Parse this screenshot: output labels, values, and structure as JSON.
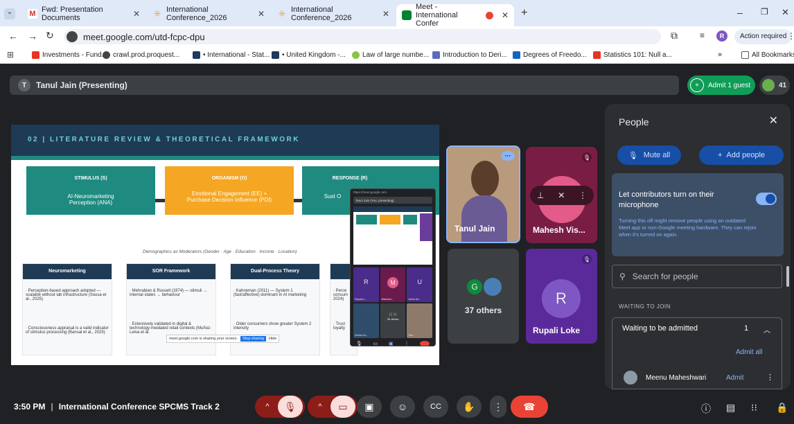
{
  "tabs": [
    {
      "title": "Fwd: Presentation Documents",
      "icon": "gmail-icon"
    },
    {
      "title": "International Conference_2026",
      "icon": "conference-icon"
    },
    {
      "title": "International Conference_2026",
      "icon": "conference-icon"
    },
    {
      "title": "Meet - International Confer",
      "icon": "meet-icon"
    }
  ],
  "address": {
    "url": "meet.google.com/utd-fcpc-dpu",
    "action_required": "Action required",
    "profile_initial": "R"
  },
  "bookmarks": [
    "Investments - Fund...",
    "crawl.prod.proquest...",
    "• International - Stat...",
    "• United Kingdom -...",
    "Law of large numbe...",
    "Introduction to Deri...",
    "Degrees of Freedo...",
    "Statistics 101: Null a..."
  ],
  "all_bookmarks": "All Bookmarks",
  "bookmarks_more": "»",
  "meet": {
    "presenter_initial": "T",
    "presenter_label": "Tanul Jain (Presenting)",
    "admit_button": "Admit 1 guest",
    "participant_count": "41",
    "time": "3:50 PM",
    "meeting_title": "International Conference SPCMS Track 2"
  },
  "slide": {
    "heading": "02  |  LITERATURE REVIEW & THEORETICAL FRAMEWORK",
    "stimulus_title": "STIMULUS (S)",
    "stimulus_body": "AI-Neuromarketing Perception (ANA)",
    "organism_title": "ORGANISM (O)",
    "organism_body": "Emotional Engagement (EE) + Purchase Decision Influence (PDI)",
    "response_title": "RESPONSE (R)",
    "response_body": "Sust O",
    "moderators": "Demographics as Moderators (Gender · Age · Education · Income · Location)",
    "cards": [
      {
        "title": "Neuromarketing",
        "p1": "· Perception-based approach adopted — scalable without lab infrastructure (Sousa et al., 2025)",
        "p2": "· Consciousness appraisal is a valid indicator of stimulus processing (Bansal et al., 2025)"
      },
      {
        "title": "SOR Framework",
        "p1": "· Mehrabian & Russell (1974) — stimuli → internal states → behaviour",
        "p2": "· Extensively validated in digital & technology-mediated retail contexts (Muñoz-Leiva et al."
      },
      {
        "title": "Dual-Process Theory",
        "p1": "· Kahneman (2011) — System 1 (fast/affective) dominant in AI marketing",
        "p2": "· Older consumers show greater System 2 intensity"
      },
      {
        "title": "",
        "p1": "· Perce consum 2024)",
        "p2": "· Trust loyalty"
      }
    ],
    "sharing_notice": "meet.google.com is sharing your screen.",
    "stop_sharing": "Stop sharing",
    "hide": "Hide"
  },
  "pip": {
    "url": "https://meet.google.com",
    "presenter": "Tanul Jain (You, presenting)",
    "tiles": [
      {
        "initial": "R",
        "name": "Rupali L..."
      },
      {
        "initial": "M",
        "name": "Mahesh..."
      },
      {
        "initial": "U",
        "name": "Usha Kir..."
      },
      {
        "initial": "",
        "name": "Disha Ku..."
      },
      {
        "initial": "G N",
        "name": "35 others"
      },
      {
        "initial": "",
        "name": "Tan..."
      }
    ]
  },
  "tiles": {
    "tanul": "Tanul Jain",
    "mahesh": "Mahesh Vis...",
    "others_initial": "G",
    "others": "37 others",
    "rupali_initial": "R",
    "rupali": "Rupali Loke"
  },
  "people": {
    "title": "People",
    "mute_all": "Mute all",
    "add_people": "Add people",
    "contrib_title": "Let contributors turn on their microphone",
    "contrib_desc": "Turning this off might remove people using an outdated Meet app or non-Google meeting hardware. They can rejoin when it's turned on again.",
    "search_placeholder": "Search for people",
    "waiting_header": "WAITING TO JOIN",
    "waiting_label": "Waiting to be admitted",
    "waiting_count": "1",
    "admit_all": "Admit all",
    "guest_name": "Meenu Maheshwari",
    "admit": "Admit"
  },
  "colors": {
    "accent": "#8ab4f8",
    "admit_green": "#34a853",
    "danger": "#ea4335",
    "slide_navy": "#1f3a55",
    "teal": "#1f8a80",
    "orange": "#f5a623"
  }
}
